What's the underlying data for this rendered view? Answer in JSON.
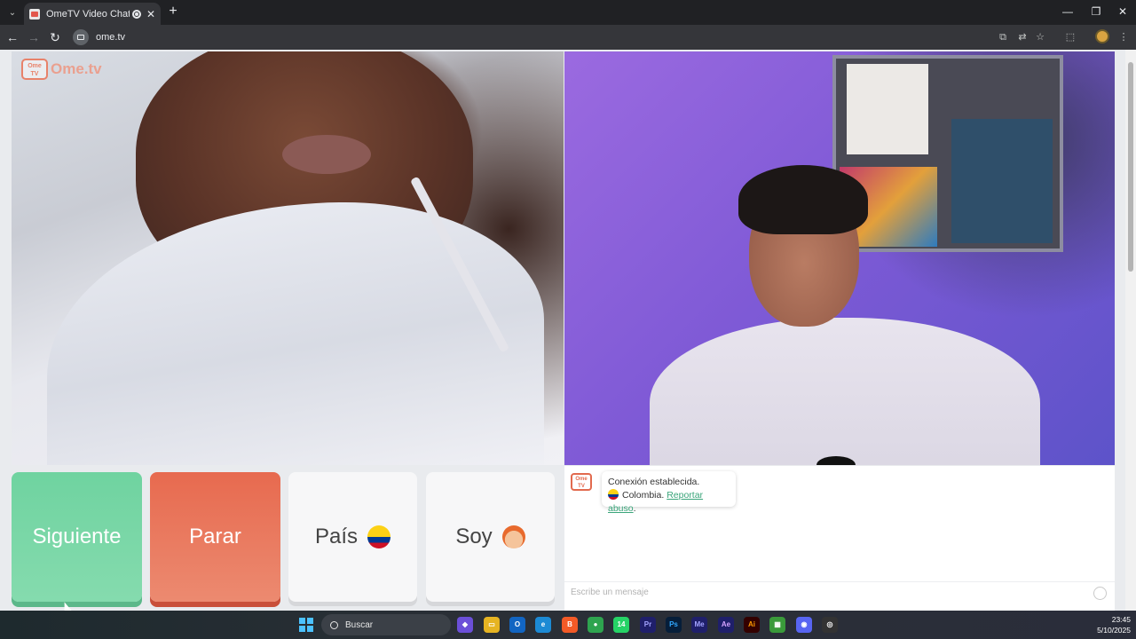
{
  "browser": {
    "tab_title": "OmeTV Video Chat — Ome",
    "url": "ome.tv"
  },
  "site": {
    "logo_icon_text": "Ome TV",
    "logo_text": "Ome.tv"
  },
  "controls": {
    "next_label": "Siguiente",
    "stop_label": "Parar",
    "country_label": "País",
    "gender_label": "Soy"
  },
  "chat": {
    "logo_text": "Ome TV",
    "status_message": "Conexión establecida.",
    "country": "Colombia.",
    "report_link": "Reportar abuso",
    "report_suffix": ".",
    "input_placeholder": "Escribe un mensaje"
  },
  "taskbar": {
    "search_label": "Buscar",
    "whatsapp_badge": "14",
    "time": "23:45",
    "date": "5/10/2025"
  },
  "colors": {
    "next_button": "#6fd3a0",
    "stop_button": "#e76a4f",
    "report_link": "#3aa57a"
  }
}
